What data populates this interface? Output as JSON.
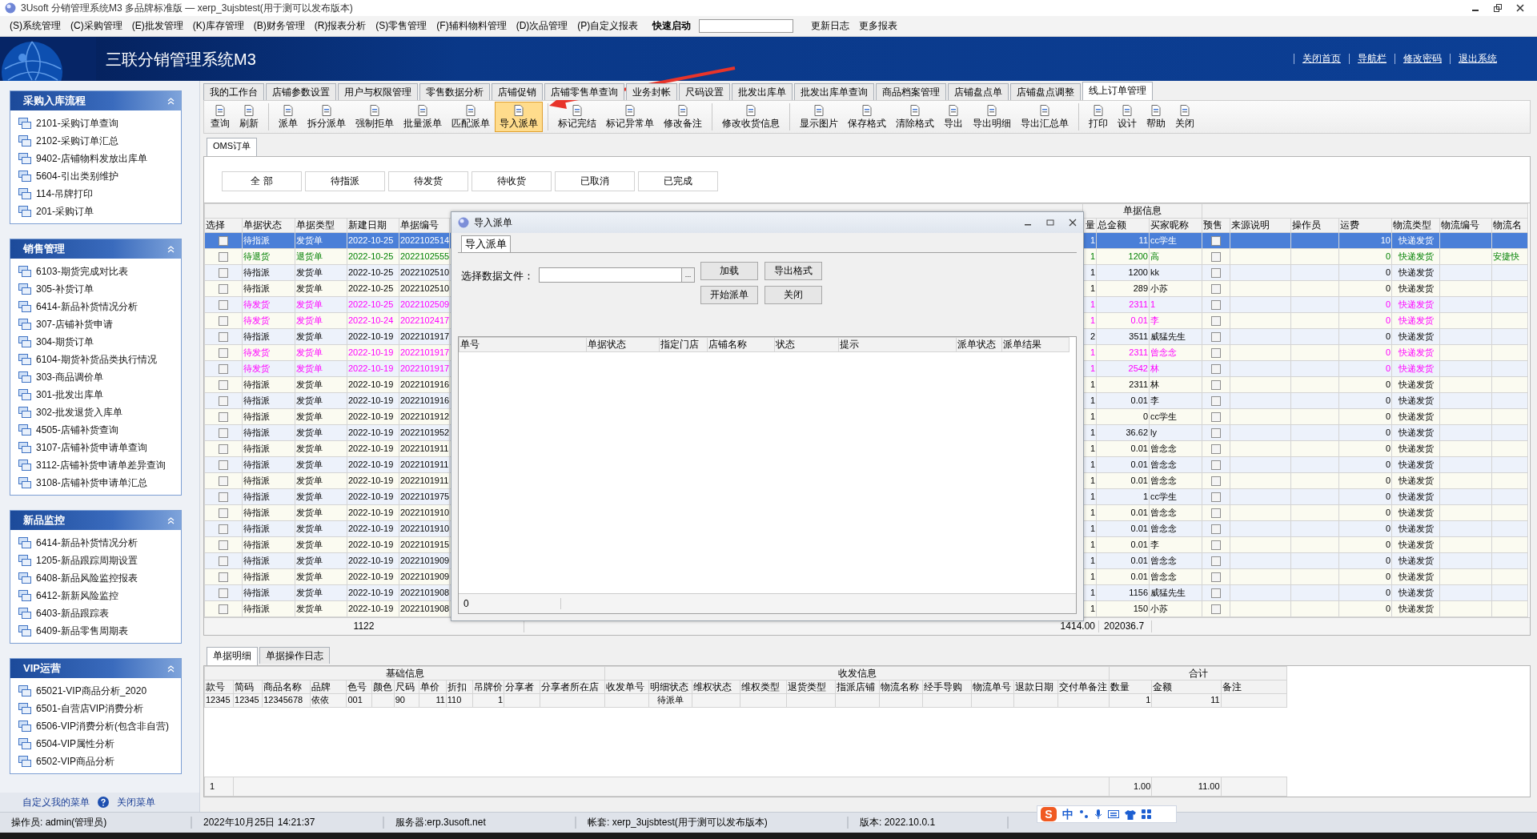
{
  "window": {
    "title": "3Usoft 分销管理系统M3 多品牌标准版 — xerp_3ujsbtest(用于测可以发布版本)"
  },
  "menu": [
    "(S)系统管理",
    "(C)采购管理",
    "(E)批发管理",
    "(K)库存管理",
    "(B)财务管理",
    "(R)报表分析",
    "(S)零售管理",
    "(F)辅料物料管理",
    "(D)次品管理",
    "(P)自定义报表"
  ],
  "quick_launch": {
    "label": "快速启动",
    "links": [
      "更新日志",
      "更多报表"
    ]
  },
  "banner": {
    "title": "三联分销管理系统M3",
    "links": [
      "关闭首页",
      "导航栏",
      "修改密码",
      "退出系统"
    ]
  },
  "sidebar": {
    "sections": [
      {
        "title": "采购入库流程",
        "items": [
          "2101-采购订单查询",
          "2102-采购订单汇总",
          "9402-店铺物料发放出库单",
          "5604-引出类别维护",
          "114-吊牌打印",
          "201-采购订单"
        ]
      },
      {
        "title": "销售管理",
        "items": [
          "6103-期货完成对比表",
          "305-补货订单",
          "6414-新品补货情况分析",
          "307-店铺补货申请",
          "304-期货订单",
          "6104-期货补货品类执行情况",
          "303-商品调价单",
          "301-批发出库单",
          "302-批发退货入库单",
          "4505-店铺补货查询",
          "3107-店铺补货申请单查询",
          "3112-店铺补货申请单差异查询",
          "3108-店铺补货申请单汇总"
        ]
      },
      {
        "title": "新品监控",
        "items": [
          "6414-新品补货情况分析",
          "1205-新品跟踪周期设置",
          "6408-新品风险监控报表",
          "6412-新新风险监控",
          "6403-新品跟踪表",
          "6409-新品零售周期表"
        ]
      },
      {
        "title": "VIP运营",
        "items": [
          "65021-VIP商品分析_2020",
          "6501-自营店VIP消费分析",
          "6506-VIP消费分析(包含非自营)",
          "6504-VIP属性分析",
          "6502-VIP商品分析"
        ]
      }
    ],
    "footer": {
      "custom": "自定义我的菜单",
      "close": "关闭菜单"
    }
  },
  "tabs": [
    {
      "label": "我的工作台",
      "selected": false
    },
    {
      "label": "店铺参数设置",
      "selected": false
    },
    {
      "label": "用户与权限管理",
      "selected": false
    },
    {
      "label": "零售数据分析",
      "selected": false
    },
    {
      "label": "店铺促销",
      "selected": false
    },
    {
      "label": "店铺零售单查询",
      "selected": false
    },
    {
      "label": "业务封帐",
      "selected": false
    },
    {
      "label": "尺码设置",
      "selected": false
    },
    {
      "label": "批发出库单",
      "selected": false
    },
    {
      "label": "批发出库单查询",
      "selected": false
    },
    {
      "label": "商品档案管理",
      "selected": false
    },
    {
      "label": "店铺盘点单",
      "selected": false
    },
    {
      "label": "店铺盘点调整",
      "selected": false
    },
    {
      "label": "线上订单管理",
      "selected": true
    }
  ],
  "toolbar": [
    {
      "buttons": [
        {
          "label": "查询",
          "highlighted": false
        },
        {
          "label": "刷新",
          "highlighted": false
        }
      ]
    },
    {
      "buttons": [
        {
          "label": "派单",
          "highlighted": false
        },
        {
          "label": "拆分派单",
          "highlighted": false
        },
        {
          "label": "强制拒单",
          "highlighted": false
        },
        {
          "label": "批量派单",
          "highlighted": false
        },
        {
          "label": "匹配派单",
          "highlighted": false
        },
        {
          "label": "导入派单",
          "highlighted": true
        }
      ]
    },
    {
      "buttons": [
        {
          "label": "标记完结",
          "highlighted": false
        },
        {
          "label": "标记异常单",
          "highlighted": false
        },
        {
          "label": "修改备注",
          "highlighted": false
        }
      ]
    },
    {
      "buttons": [
        {
          "label": "修改收货信息",
          "highlighted": false
        }
      ]
    },
    {
      "buttons": [
        {
          "label": "显示图片",
          "highlighted": false
        },
        {
          "label": "保存格式",
          "highlighted": false
        },
        {
          "label": "清除格式",
          "highlighted": false
        },
        {
          "label": "导出",
          "highlighted": false
        },
        {
          "label": "导出明细",
          "highlighted": false
        },
        {
          "label": "导出汇总单",
          "highlighted": false
        }
      ]
    },
    {
      "buttons": [
        {
          "label": "打印",
          "highlighted": false
        },
        {
          "label": "设计",
          "highlighted": false
        },
        {
          "label": "帮助",
          "highlighted": false
        },
        {
          "label": "关闭",
          "highlighted": false
        }
      ]
    }
  ],
  "subtabs": [
    {
      "label": "OMS订单",
      "selected": true
    }
  ],
  "filters": [
    "全 部",
    "待指派",
    "待发货",
    "待收货",
    "已取消",
    "已完成"
  ],
  "orders": {
    "group_header": "单据信息",
    "columns": [
      "选择",
      "单据状态",
      "单据类型",
      "新建日期",
      "单据编号",
      "量",
      "总金额",
      "买家昵称",
      "预售",
      "来源说明",
      "操作员",
      "运费",
      "物流类型",
      "物流编号",
      "物流名"
    ],
    "rows": [
      {
        "checked": false,
        "status": "待指派",
        "type": "发货单",
        "date": "2022-10-25",
        "code": "2022102514",
        "qty": "1",
        "amount": "11",
        "buyer": "cc学生",
        "presale": false,
        "freight": "10",
        "logistics_type": "快递发货",
        "selected": true,
        "kind": "normal"
      },
      {
        "checked": false,
        "status": "待退货",
        "type": "退货单",
        "date": "2022-10-25",
        "code": "2022102555",
        "qty": "1",
        "amount": "1200",
        "buyer": "高",
        "presale": false,
        "freight": "0",
        "logistics_type": "快递发货",
        "logistics_name": "安捷快",
        "selected": false,
        "kind": "return"
      },
      {
        "checked": false,
        "status": "待指派",
        "type": "发货单",
        "date": "2022-10-25",
        "code": "2022102510",
        "qty": "1",
        "amount": "1200",
        "buyer": "kk",
        "presale": false,
        "freight": "0",
        "logistics_type": "快递发货",
        "selected": false,
        "kind": "normal"
      },
      {
        "checked": false,
        "status": "待指派",
        "type": "发货单",
        "date": "2022-10-25",
        "code": "2022102510",
        "qty": "1",
        "amount": "289",
        "buyer": "小苏",
        "presale": false,
        "freight": "0",
        "logistics_type": "快递发货",
        "selected": false,
        "kind": "normal"
      },
      {
        "checked": false,
        "status": "待发货",
        "type": "发货单",
        "date": "2022-10-25",
        "code": "2022102509",
        "qty": "1",
        "amount": "2311",
        "buyer": "1",
        "presale": false,
        "freight": "0",
        "logistics_type": "快递发货",
        "selected": false,
        "kind": "shipping"
      },
      {
        "checked": false,
        "status": "待发货",
        "type": "发货单",
        "date": "2022-10-24",
        "code": "2022102417",
        "qty": "1",
        "amount": "0.01",
        "buyer": "李",
        "presale": false,
        "freight": "0",
        "logistics_type": "快递发货",
        "selected": false,
        "kind": "shipping"
      },
      {
        "checked": false,
        "status": "待指派",
        "type": "发货单",
        "date": "2022-10-19",
        "code": "2022101917",
        "qty": "2",
        "amount": "3511",
        "buyer": "威猛先生",
        "presale": false,
        "freight": "0",
        "logistics_type": "快递发货",
        "selected": false,
        "kind": "normal"
      },
      {
        "checked": false,
        "status": "待发货",
        "type": "发货单",
        "date": "2022-10-19",
        "code": "2022101917",
        "qty": "1",
        "amount": "2311",
        "buyer": "曾念念",
        "presale": false,
        "freight": "0",
        "logistics_type": "快递发货",
        "selected": false,
        "kind": "shipping"
      },
      {
        "checked": false,
        "status": "待发货",
        "type": "发货单",
        "date": "2022-10-19",
        "code": "2022101917",
        "qty": "1",
        "amount": "2542",
        "buyer": "林",
        "presale": false,
        "freight": "0",
        "logistics_type": "快递发货",
        "selected": false,
        "kind": "shipping"
      },
      {
        "checked": false,
        "status": "待指派",
        "type": "发货单",
        "date": "2022-10-19",
        "code": "2022101916",
        "qty": "1",
        "amount": "2311",
        "buyer": "林",
        "presale": false,
        "freight": "0",
        "logistics_type": "快递发货",
        "selected": false,
        "kind": "normal"
      },
      {
        "checked": false,
        "status": "待指派",
        "type": "发货单",
        "date": "2022-10-19",
        "code": "2022101916",
        "qty": "1",
        "amount": "0.01",
        "buyer": "李",
        "presale": false,
        "freight": "0",
        "logistics_type": "快递发货",
        "selected": false,
        "kind": "normal"
      },
      {
        "checked": false,
        "status": "待指派",
        "type": "发货单",
        "date": "2022-10-19",
        "code": "2022101912",
        "qty": "1",
        "amount": "0",
        "buyer": "cc学生",
        "presale": false,
        "freight": "0",
        "logistics_type": "快递发货",
        "selected": false,
        "kind": "normal"
      },
      {
        "checked": false,
        "status": "待指派",
        "type": "发货单",
        "date": "2022-10-19",
        "code": "2022101952",
        "qty": "1",
        "amount": "36.62",
        "buyer": "ly",
        "presale": false,
        "freight": "0",
        "logistics_type": "快递发货",
        "selected": false,
        "kind": "normal"
      },
      {
        "checked": false,
        "status": "待指派",
        "type": "发货单",
        "date": "2022-10-19",
        "code": "2022101911",
        "qty": "1",
        "amount": "0.01",
        "buyer": "曾念念",
        "presale": false,
        "freight": "0",
        "logistics_type": "快递发货",
        "selected": false,
        "kind": "normal"
      },
      {
        "checked": false,
        "status": "待指派",
        "type": "发货单",
        "date": "2022-10-19",
        "code": "2022101911",
        "qty": "1",
        "amount": "0.01",
        "buyer": "曾念念",
        "presale": false,
        "freight": "0",
        "logistics_type": "快递发货",
        "selected": false,
        "kind": "normal"
      },
      {
        "checked": false,
        "status": "待指派",
        "type": "发货单",
        "date": "2022-10-19",
        "code": "2022101911",
        "qty": "1",
        "amount": "0.01",
        "buyer": "曾念念",
        "presale": false,
        "freight": "0",
        "logistics_type": "快递发货",
        "selected": false,
        "kind": "normal"
      },
      {
        "checked": false,
        "status": "待指派",
        "type": "发货单",
        "date": "2022-10-19",
        "code": "2022101975",
        "qty": "1",
        "amount": "1",
        "buyer": "cc学生",
        "presale": false,
        "freight": "0",
        "logistics_type": "快递发货",
        "selected": false,
        "kind": "normal"
      },
      {
        "checked": false,
        "status": "待指派",
        "type": "发货单",
        "date": "2022-10-19",
        "code": "2022101910",
        "qty": "1",
        "amount": "0.01",
        "buyer": "曾念念",
        "presale": false,
        "freight": "0",
        "logistics_type": "快递发货",
        "selected": false,
        "kind": "normal"
      },
      {
        "checked": false,
        "status": "待指派",
        "type": "发货单",
        "date": "2022-10-19",
        "code": "2022101910",
        "qty": "1",
        "amount": "0.01",
        "buyer": "曾念念",
        "presale": false,
        "freight": "0",
        "logistics_type": "快递发货",
        "selected": false,
        "kind": "normal"
      },
      {
        "checked": false,
        "status": "待指派",
        "type": "发货单",
        "date": "2022-10-19",
        "code": "2022101915",
        "qty": "1",
        "amount": "0.01",
        "buyer": "李",
        "presale": false,
        "freight": "0",
        "logistics_type": "快递发货",
        "selected": false,
        "kind": "normal"
      },
      {
        "checked": false,
        "status": "待指派",
        "type": "发货单",
        "date": "2022-10-19",
        "code": "2022101909",
        "qty": "1",
        "amount": "0.01",
        "buyer": "曾念念",
        "presale": false,
        "freight": "0",
        "logistics_type": "快递发货",
        "selected": false,
        "kind": "normal"
      },
      {
        "checked": false,
        "status": "待指派",
        "type": "发货单",
        "date": "2022-10-19",
        "code": "2022101909",
        "qty": "1",
        "amount": "0.01",
        "buyer": "曾念念",
        "presale": false,
        "freight": "0",
        "logistics_type": "快递发货",
        "selected": false,
        "kind": "normal"
      },
      {
        "checked": false,
        "status": "待指派",
        "type": "发货单",
        "date": "2022-10-19",
        "code": "2022101908",
        "qty": "1",
        "amount": "1156",
        "buyer": "威猛先生",
        "presale": false,
        "freight": "0",
        "logistics_type": "快递发货",
        "selected": false,
        "kind": "normal"
      },
      {
        "checked": false,
        "status": "待指派",
        "type": "发货单",
        "date": "2022-10-19",
        "code": "2022101908",
        "qty": "1",
        "amount": "150",
        "buyer": "小苏",
        "presale": false,
        "freight": "0",
        "logistics_type": "快递发货",
        "selected": false,
        "kind": "normal"
      }
    ],
    "footer": {
      "count": "1122",
      "qty_total": "1414.00",
      "amount_total": "202036.7"
    }
  },
  "dialog": {
    "title": "导入派单",
    "tab": "导入派单",
    "file_label": "选择数据文件：",
    "browse": "...",
    "buttons": [
      "加载",
      "导出格式",
      "开始派单",
      "关闭"
    ],
    "columns": [
      "单号",
      "单据状态",
      "指定门店",
      "店铺名称",
      "状态",
      "提示",
      "派单状态",
      "派单结果"
    ],
    "footer": "0"
  },
  "detail": {
    "tabs": [
      {
        "label": "单据明细",
        "selected": true
      },
      {
        "label": "单据操作日志",
        "selected": false
      }
    ],
    "groups": [
      {
        "title": "基础信息",
        "columns": [
          "款号",
          "简码",
          "商品名称",
          "品牌",
          "色号",
          "颜色",
          "尺码",
          "单价",
          "折扣",
          "吊牌价",
          "分享者",
          "分享者所在店"
        ]
      },
      {
        "title": "收发信息",
        "columns": [
          "收发单号",
          "明细状态",
          "维权状态",
          "维权类型",
          "退货类型",
          "指派店铺",
          "物流名称",
          "经手导购",
          "物流单号",
          "退款日期",
          "交付单备注"
        ]
      },
      {
        "title": "合计",
        "columns": [
          "数量",
          "金额",
          "备注"
        ]
      }
    ],
    "rows": [
      [
        "12345",
        "12345",
        "12345678",
        "依依",
        "001",
        null,
        "90",
        "11",
        "110",
        "1",
        null,
        null,
        null,
        "待派单",
        null,
        null,
        null,
        null,
        null,
        null,
        null,
        null,
        null,
        "1",
        "11",
        null
      ]
    ],
    "footer": {
      "count": "1",
      "qty": "1.00",
      "amount": "11.00"
    }
  },
  "status_bar": [
    "操作员: admin(管理员)",
    "2022年10月25日 14:21:37",
    "服务器:erp.3usoft.net",
    "帐套: xerp_3ujsbtest(用于测可以发布版本)",
    "版本: 2022.10.0.1"
  ],
  "ime": {
    "logo": "S",
    "mode": "中"
  }
}
